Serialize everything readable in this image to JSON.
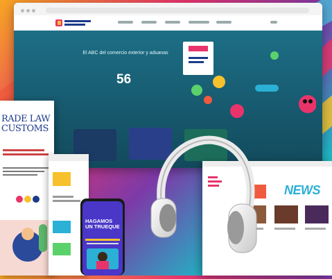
{
  "brand": {
    "logo_text": "TRADE LAW & CUSTOMS"
  },
  "browser": {
    "hero_text": "El ABC del comercio exterior y aduanas",
    "hero_number": "56"
  },
  "tablet": {
    "title_line1": "RADE LAW",
    "title_line2": "CUSTOMS"
  },
  "phone": {
    "headline_line1": "HAGAMOS",
    "headline_line2": "UN TRUEQUE"
  },
  "news": {
    "title": "NEWS"
  },
  "icons": [
    "headphones-icon"
  ],
  "colors": {
    "hero_bg": "#1d6f86",
    "news_accent": "#2bb0d6",
    "phone_bg": "#4a37c8"
  }
}
